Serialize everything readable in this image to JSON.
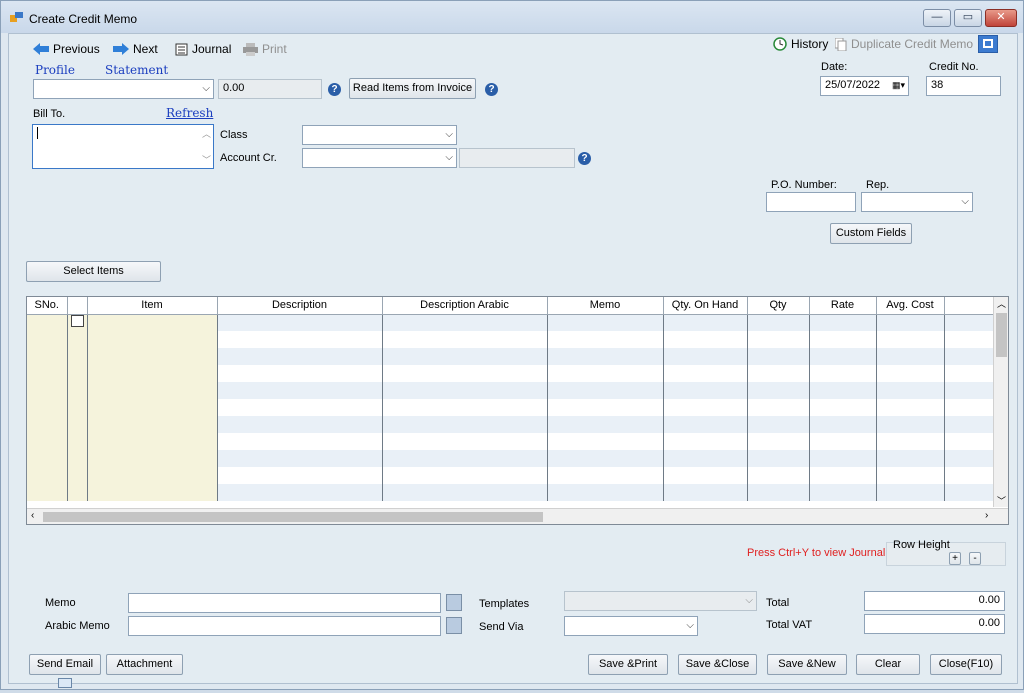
{
  "window": {
    "title": "Create Credit Memo",
    "controls": [
      "—",
      "▭",
      "✕"
    ]
  },
  "toolbar": {
    "previous": "Previous",
    "next": "Next",
    "journal": "Journal",
    "print": "Print",
    "history": "History",
    "duplicate": "Duplicate Credit Memo"
  },
  "links": {
    "profile": "Profile",
    "statement": "Statement",
    "refresh": "Refresh"
  },
  "customer": {
    "value": "",
    "balance": "0.00",
    "read_items_button": "Read Items from Invoice"
  },
  "header": {
    "date_label": "Date:",
    "date_value": "25/07/2022",
    "credit_no_label": "Credit No.",
    "credit_no_value": "38",
    "bill_to_label": "Bill To.",
    "class_label": "Class",
    "account_label": "Account Cr.",
    "po_label": "P.O. Number:",
    "rep_label": "Rep.",
    "custom_fields_button": "Custom Fields",
    "select_items_button": "Select Items"
  },
  "grid": {
    "columns": [
      "SNo.",
      "",
      "Item",
      "Description",
      "Description Arabic",
      "Memo",
      "Qty. On Hand",
      "Qty",
      "Rate",
      "Avg. Cost",
      ""
    ]
  },
  "footer": {
    "journal_hint": "Press Ctrl+Y to view Journal",
    "row_height_label": "Row Height",
    "row_plus": "+",
    "row_minus": "-",
    "memo_label": "Memo",
    "arabic_memo_label": "Arabic Memo",
    "templates_label": "Templates",
    "send_via_label": "Send Via",
    "total_label": "Total",
    "total_value": "0.00",
    "total_vat_label": "Total VAT",
    "total_vat_value": "0.00",
    "send_email_button": "Send Email",
    "attachment_button": "Attachment",
    "save_print_button": "Save &Print",
    "save_close_button": "Save &Close",
    "save_new_button": "Save &New",
    "clear_button": "Clear",
    "close_button": "Close(F10)"
  },
  "colors": {
    "link": "#1a3dbf",
    "hint_red": "#e02020",
    "item_column_beige": "#f5f3dc",
    "row_alt": "#e9f0f7"
  }
}
